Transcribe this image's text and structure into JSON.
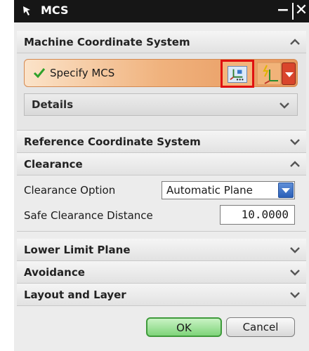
{
  "window": {
    "title": "MCS",
    "minimize_glyph": "−",
    "close_glyph": "✕"
  },
  "sections": {
    "mcs": {
      "label": "Machine Coordinate System",
      "state": "expanded"
    },
    "specify": {
      "label": "Specify MCS",
      "status": "complete"
    },
    "details": {
      "label": "Details",
      "state": "collapsed"
    },
    "rcs": {
      "label": "Reference Coordinate System",
      "state": "collapsed"
    },
    "clearance": {
      "label": "Clearance",
      "state": "expanded"
    },
    "lower": {
      "label": "Lower Limit Plane",
      "state": "collapsed"
    },
    "avoidance": {
      "label": "Avoidance",
      "state": "collapsed"
    },
    "layout": {
      "label": "Layout and Layer",
      "state": "collapsed"
    }
  },
  "clearance": {
    "option_label": "Clearance Option",
    "option_value": "Automatic Plane",
    "distance_label": "Safe Clearance Distance",
    "distance_value": "10.0000"
  },
  "footer": {
    "ok_label": "OK",
    "cancel_label": "Cancel"
  },
  "colors": {
    "titlebar": "#161616",
    "specify_row_gradient": [
      "#fbe3c9",
      "#e6955a"
    ],
    "highlight_border": "#e01010",
    "ok_button": "#7fd47a",
    "select_button": "#2b5fb8"
  }
}
